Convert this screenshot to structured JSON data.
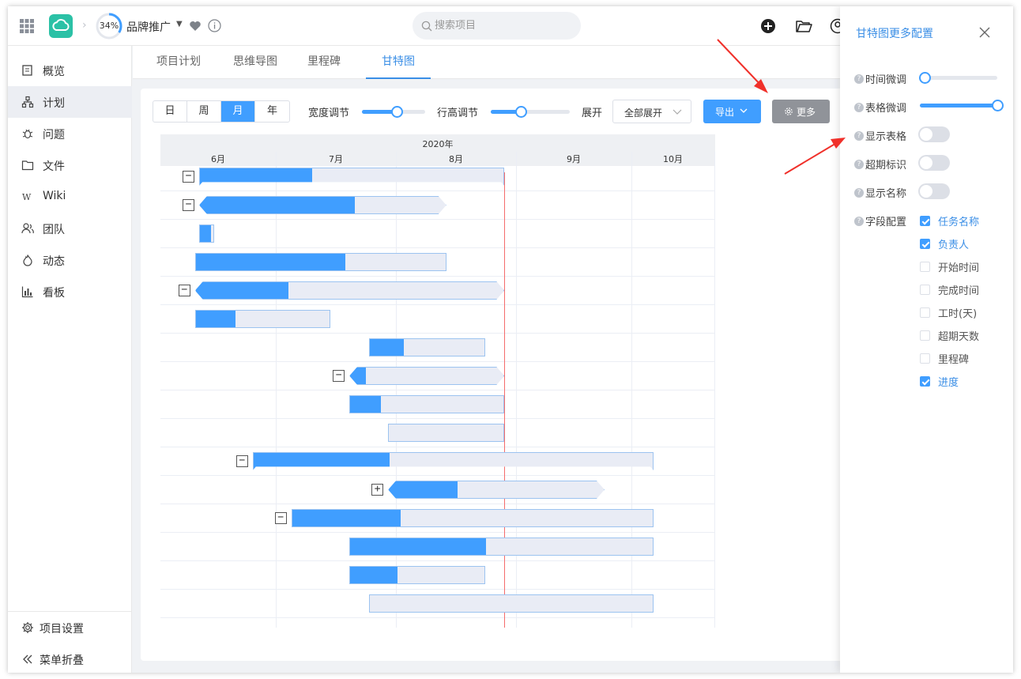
{
  "header": {
    "progress": "34%",
    "progress_value": 0.34,
    "project_name": "品牌推广",
    "search_placeholder": "搜索项目",
    "brand_color": "#2bc1a6",
    "icons": [
      "apps-grid-icon",
      "cloud-logo-icon",
      "heart-icon",
      "info-icon",
      "search-icon",
      "add-icon",
      "folder-icon",
      "user-icon"
    ]
  },
  "sidebar": {
    "items": [
      {
        "label": "概览",
        "icon": "overview-icon"
      },
      {
        "label": "计划",
        "icon": "plan-icon",
        "active": true
      },
      {
        "label": "问题",
        "icon": "bug-icon"
      },
      {
        "label": "文件",
        "icon": "folder-icon"
      },
      {
        "label": "Wiki",
        "icon": "wiki-icon"
      },
      {
        "label": "团队",
        "icon": "team-icon"
      },
      {
        "label": "动态",
        "icon": "activity-icon"
      },
      {
        "label": "看板",
        "icon": "board-icon"
      }
    ],
    "settings": "项目设置",
    "collapse": "菜单折叠"
  },
  "tabs": [
    "项目计划",
    "思维导图",
    "里程碑",
    "甘特图"
  ],
  "active_tab": "甘特图",
  "toolbar": {
    "scale": [
      "日",
      "周",
      "月",
      "年"
    ],
    "active_scale": "月",
    "width_label": "宽度调节",
    "width_value": 0.55,
    "height_label": "行高调节",
    "height_value": 0.38,
    "expand_label": "展开",
    "expand_value": "全部展开",
    "export_label": "导出",
    "more_label": "更多",
    "accent": "#409eff"
  },
  "gantt": {
    "year": "2020年",
    "months": [
      "6月",
      "7月",
      "8月",
      "9月",
      "10月"
    ],
    "today": "2020-08-29",
    "tasks": [
      {
        "start": "2020-06-01",
        "end": "2020-08-29",
        "progress": 0.37,
        "kind": "summary",
        "toggle": "−"
      },
      {
        "start": "2020-06-01",
        "end": "2020-08-14",
        "progress": 0.63,
        "kind": "group",
        "toggle": "−"
      },
      {
        "start": "2020-06-01",
        "end": "2020-06-15",
        "progress": 0.8,
        "kind": "task"
      },
      {
        "start": "2020-06-10",
        "end": "2020-08-14",
        "progress": 0.6,
        "kind": "task"
      },
      {
        "start": "2020-06-10",
        "end": "2020-08-29",
        "progress": 0.3,
        "kind": "group",
        "toggle": "−"
      },
      {
        "start": "2020-06-10",
        "end": "2020-07-15",
        "progress": 0.3,
        "kind": "task"
      },
      {
        "start": "2020-07-25",
        "end": "2020-08-24",
        "progress": 0.3,
        "kind": "task"
      },
      {
        "start": "2020-07-20",
        "end": "2020-08-29",
        "progress": 0.1,
        "kind": "group",
        "toggle": "−"
      },
      {
        "start": "2020-07-20",
        "end": "2020-08-29",
        "progress": 0.2,
        "kind": "task"
      },
      {
        "start": "2020-07-30",
        "end": "2020-08-29",
        "progress": 0.0,
        "kind": "task"
      },
      {
        "start": "2020-06-25",
        "end": "2020-10-09",
        "progress": 0.34,
        "kind": "summary",
        "toggle": "−"
      },
      {
        "start": "2020-07-30",
        "end": "2020-09-24",
        "progress": 0.32,
        "kind": "group",
        "toggle": "+"
      },
      {
        "start": "2020-07-05",
        "end": "2020-10-09",
        "progress": 0.3,
        "kind": "task",
        "toggle": "−"
      },
      {
        "start": "2020-07-20",
        "end": "2020-10-09",
        "progress": 0.45,
        "kind": "task"
      },
      {
        "start": "2020-07-20",
        "end": "2020-08-24",
        "progress": 0.35,
        "kind": "task"
      },
      {
        "start": "2020-07-25",
        "end": "2020-10-09",
        "progress": 0.0,
        "kind": "task"
      }
    ]
  },
  "config": {
    "title": "甘特图更多配置",
    "time_fine": "时间微调",
    "time_fine_value": 0.0,
    "table_fine": "表格微调",
    "table_fine_value": 1.0,
    "show_table": "显示表格",
    "show_table_on": false,
    "overdue_mark": "超期标识",
    "overdue_mark_on": false,
    "show_name": "显示名称",
    "show_name_on": false,
    "fields_label": "字段配置",
    "fields": [
      {
        "label": "任务名称",
        "checked": true
      },
      {
        "label": "负责人",
        "checked": true
      },
      {
        "label": "开始时间",
        "checked": false
      },
      {
        "label": "完成时间",
        "checked": false
      },
      {
        "label": "工时(天)",
        "checked": false
      },
      {
        "label": "超期天数",
        "checked": false
      },
      {
        "label": "里程碑",
        "checked": false
      },
      {
        "label": "进度",
        "checked": true
      }
    ]
  }
}
